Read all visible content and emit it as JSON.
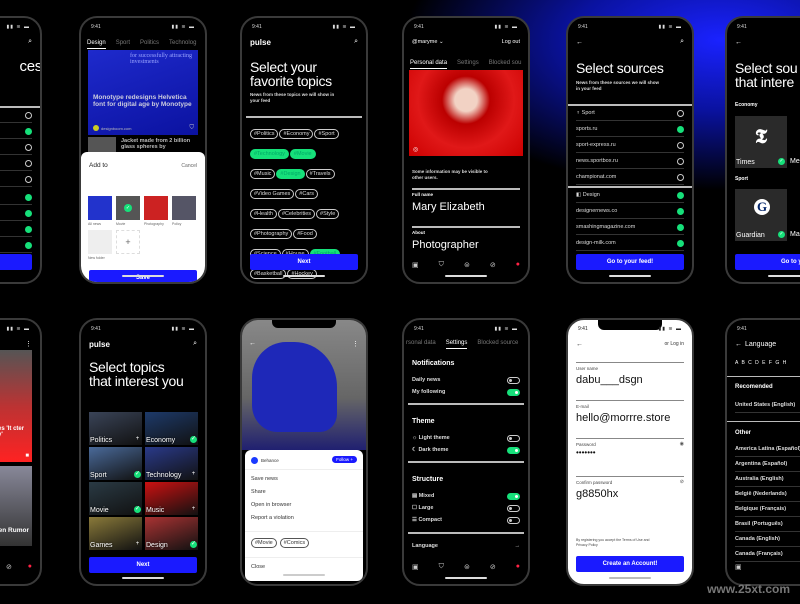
{
  "status_time": "9:41",
  "watermark": "www.25xt.com",
  "screen_sources_partial": {
    "title": "ces",
    "rows": [
      false,
      true,
      false,
      false,
      false,
      true,
      true,
      true,
      true
    ],
    "button": "d!"
  },
  "screen_feed": {
    "tabs": [
      "Design",
      "Sport",
      "Politics",
      "Technolog"
    ],
    "card_overlay": "for successfully attracting investments",
    "card_title": "Monotype redesigns Helvetica font for digital age by Monotype",
    "card_source": "designboom.com",
    "second_title": "Jacket made from 2 billion glass spheres by",
    "sheet": {
      "title": "Add to",
      "cancel": "Cancel",
      "folders": [
        {
          "label": "All news",
          "color": "#2233cc"
        },
        {
          "label": "Movie",
          "color": "#555",
          "checked": true
        },
        {
          "label": "Photography",
          "color": "#c22"
        },
        {
          "label": "Policy",
          "color": "#556"
        }
      ],
      "new_folder": "New folder",
      "plus": "+",
      "save": "Save"
    }
  },
  "screen_topics": {
    "logo": "pulse",
    "title_l1": "Select your",
    "title_l2": "favorite topics",
    "subtitle": "News from these topics we will show in your feed",
    "chips": [
      {
        "label": "#Politics",
        "on": false
      },
      {
        "label": "#Economy",
        "on": false
      },
      {
        "label": "#Sport",
        "on": false
      },
      {
        "label": "#Technology",
        "on": true
      },
      {
        "label": "#Movie",
        "on": true
      },
      {
        "label": "#Music",
        "on": false
      },
      {
        "label": "#Design",
        "on": true
      },
      {
        "label": "#Travels",
        "on": false
      },
      {
        "label": "#Video Games",
        "on": false
      },
      {
        "label": "#Cars",
        "on": false
      },
      {
        "label": "#Health",
        "on": false
      },
      {
        "label": "#Celebrities",
        "on": false
      },
      {
        "label": "#Style",
        "on": false
      },
      {
        "label": "#Photography",
        "on": false
      },
      {
        "label": "#Food",
        "on": false
      },
      {
        "label": "#Science",
        "on": false
      },
      {
        "label": "#House",
        "on": false
      },
      {
        "label": "#Football",
        "on": true
      },
      {
        "label": "#Basketball",
        "on": false
      },
      {
        "label": "#Hockey",
        "on": false
      }
    ],
    "next": "Next"
  },
  "screen_profile": {
    "username": "@maryme ⌄",
    "logout": "Log out",
    "tabs": [
      "Personal data",
      "Settings",
      "Blocked sou"
    ],
    "notice": "Some information may be visible to other users.",
    "fullname_label": "Full name",
    "fullname": "Mary Elizabeth",
    "about_label": "About",
    "about": "Photographer"
  },
  "screen_select_sources": {
    "title": "Select sources",
    "subtitle": "News from these sources we will show in your feed",
    "groups": [
      {
        "name": "Sport",
        "selected": false,
        "items": [
          {
            "name": "sports.ru",
            "selected": true
          },
          {
            "name": "sport-express.ru",
            "selected": false
          },
          {
            "name": "news.sportbox.ru",
            "selected": false
          },
          {
            "name": "championat.com",
            "selected": false
          }
        ]
      },
      {
        "name": "Design",
        "selected": true,
        "items": [
          {
            "name": "designernews.co",
            "selected": true
          },
          {
            "name": "smashingmagazine.com",
            "selected": true
          },
          {
            "name": "design-milk.com",
            "selected": true
          }
        ]
      }
    ],
    "button": "Go to your feed!"
  },
  "screen_sources_tiles": {
    "title_l1": "Select sou",
    "title_l2": "that intere",
    "section1": "Economy",
    "tile1": "Times",
    "tile1b": "Me",
    "section2": "Sport",
    "tile2": "Guardian",
    "tile2b": "Ma",
    "button": "Go to your f"
  },
  "screen_feed2_partial": {
    "card1": "es 'It cter y'",
    "card2": "en Rumor"
  },
  "screen_topic_tiles": {
    "logo": "pulse",
    "title_l1": "Select topics",
    "title_l2": "that interest you",
    "tiles": [
      {
        "label": "Politics",
        "on": false,
        "color": "#3a4458"
      },
      {
        "label": "Economy",
        "on": true,
        "color": "#1d3a6a"
      },
      {
        "label": "Sport",
        "on": true,
        "color": "#4a6a9a"
      },
      {
        "label": "Technology",
        "on": false,
        "color": "#2a3a8a"
      },
      {
        "label": "Movie",
        "on": true,
        "color": "#2a3a44"
      },
      {
        "label": "Music",
        "on": false,
        "color": "#c11"
      },
      {
        "label": "Games",
        "on": false,
        "color": "#8a7a3a"
      },
      {
        "label": "Design",
        "on": true,
        "color": "#a33"
      }
    ],
    "next": "Next"
  },
  "screen_article_menu": {
    "source": "Behance",
    "follow": "Follow +",
    "actions": [
      "Save news",
      "Share",
      "Open in browser",
      "Report a violation"
    ],
    "tags": [
      "#Movie",
      "#Comics"
    ],
    "close": "Close"
  },
  "screen_settings": {
    "tabs": [
      "rsonal data",
      "Settings",
      "Blocked source"
    ],
    "notifications": "Notifications",
    "notif_items": [
      {
        "label": "Daily news",
        "on": false
      },
      {
        "label": "My following",
        "on": true
      }
    ],
    "theme": "Theme",
    "theme_items": [
      {
        "label": "☼ Light theme",
        "on": false
      },
      {
        "label": "☾ Dark theme",
        "on": true
      }
    ],
    "structure": "Structure",
    "structure_items": [
      {
        "label": "▤ Mixed",
        "on": true
      },
      {
        "label": "☐ Large",
        "on": false
      },
      {
        "label": "☰ Compact",
        "on": false
      }
    ],
    "language": "Language"
  },
  "screen_signup": {
    "login": "or Log in",
    "username_label": "User name",
    "username": "dabu___dsgn",
    "email_label": "E-mail",
    "email": "hello@morrre.store",
    "password_label": "Password",
    "password": "•••••••",
    "confirm_label": "Confirm password",
    "confirm": "g8850hx",
    "terms": "By registering you accept the Terms of Use and Privacy Policy",
    "button": "Create an Account!"
  },
  "screen_language": {
    "title": "Language",
    "letters": "A B C D E F G H",
    "recommended": "Recomended",
    "recommended_items": [
      "United States (English)"
    ],
    "other": "Other",
    "other_items": [
      "America Latina (Español)",
      "Argentina (Español)",
      "Australia (English)",
      "België (Nederlands)",
      "Belgique (Français)",
      "Brasil (Português)",
      "Canada (English)",
      "Canada (Français)"
    ]
  }
}
